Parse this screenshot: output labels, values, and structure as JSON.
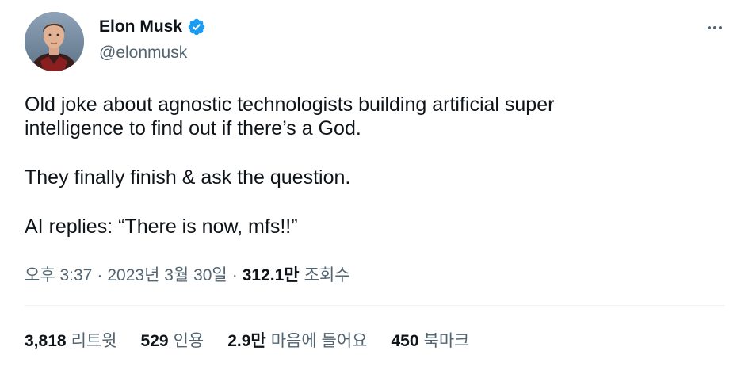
{
  "author": {
    "name": "Elon Musk",
    "handle": "@elonmusk",
    "verified": true,
    "verified_color": "#1d9bf0"
  },
  "tweet": {
    "paragraphs": [
      "Old joke about agnostic technologists building artificial super\nintelligence to find out if there’s a God.",
      "They finally finish & ask the question.",
      "AI replies: “There is now, mfs!!”"
    ]
  },
  "meta": {
    "time": "오후 3:37",
    "separator": "·",
    "date": "2023년 3월 30일",
    "views_count": "312.1만",
    "views_label": "조회수"
  },
  "stats": [
    {
      "count": "3,818",
      "label": "리트윗"
    },
    {
      "count": "529",
      "label": "인용"
    },
    {
      "count": "2.9만",
      "label": "마음에 들어요"
    },
    {
      "count": "450",
      "label": "북마크"
    }
  ],
  "icons": {
    "more": "more-horizontal-icon",
    "verified": "verified-badge-icon"
  },
  "colors": {
    "primary_text": "#0f1419",
    "secondary_text": "#536471",
    "divider": "#eff3f4"
  }
}
